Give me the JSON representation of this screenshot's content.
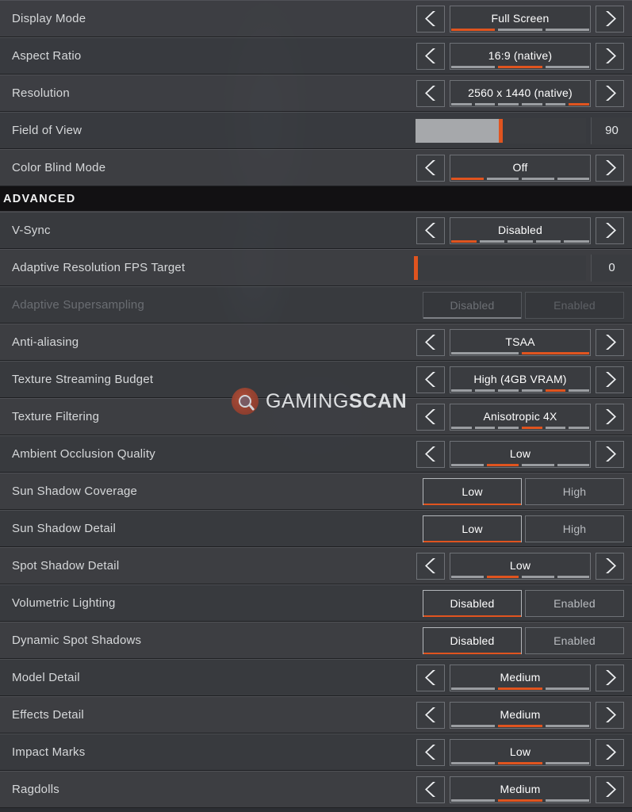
{
  "watermark": {
    "thin": "GAMING",
    "bold": "SCAN",
    "logo_icon": "magnifier-icon"
  },
  "theme": {
    "accent": "#e0541f",
    "row_bg": "#3e4044",
    "control_bg": "#3a3c40",
    "border": "#6e7176",
    "section_bg": "#121113",
    "text": "#d6d8da",
    "text_bright": "#ffffff",
    "text_dim": "#6a6d72",
    "segment_off": "#9a9da1"
  },
  "arrows": {
    "left_icon": "chevron-left-icon",
    "right_icon": "chevron-right-icon"
  },
  "rows": [
    {
      "id": "display-mode",
      "label": "Display Mode",
      "type": "stepper",
      "value": "Full Screen",
      "segments": 3,
      "active": 1
    },
    {
      "id": "aspect-ratio",
      "label": "Aspect Ratio",
      "type": "stepper",
      "value": "16:9 (native)",
      "segments": 3,
      "active": 2
    },
    {
      "id": "resolution",
      "label": "Resolution",
      "type": "stepper",
      "value": "2560 x 1440 (native)",
      "segments": 6,
      "active": 6
    },
    {
      "id": "field-of-view",
      "label": "Field of View",
      "type": "slider",
      "value": "90",
      "percent": 50
    },
    {
      "id": "color-blind-mode",
      "label": "Color Blind Mode",
      "type": "stepper",
      "value": "Off",
      "segments": 4,
      "active": 1
    },
    {
      "id": "advanced",
      "label": "ADVANCED",
      "type": "section"
    },
    {
      "id": "v-sync",
      "label": "V-Sync",
      "type": "stepper",
      "value": "Disabled",
      "segments": 5,
      "active": 1
    },
    {
      "id": "adaptive-res-fps",
      "label": "Adaptive Resolution FPS Target",
      "type": "slider",
      "value": "0",
      "percent": 0
    },
    {
      "id": "adaptive-supersampling",
      "label": "Adaptive Supersampling",
      "type": "toggle",
      "options": [
        "Disabled",
        "Enabled"
      ],
      "selected": 0,
      "disabled": true
    },
    {
      "id": "anti-aliasing",
      "label": "Anti-aliasing",
      "type": "stepper",
      "value": "TSAA",
      "segments": 2,
      "active": 2
    },
    {
      "id": "texture-streaming-budget",
      "label": "Texture Streaming Budget",
      "type": "stepper",
      "value": "High (4GB VRAM)",
      "segments": 6,
      "active": 5
    },
    {
      "id": "texture-filtering",
      "label": "Texture Filtering",
      "type": "stepper",
      "value": "Anisotropic 4X",
      "segments": 6,
      "active": 4
    },
    {
      "id": "ambient-occlusion-quality",
      "label": "Ambient Occlusion Quality",
      "type": "stepper",
      "value": "Low",
      "segments": 4,
      "active": 2
    },
    {
      "id": "sun-shadow-coverage",
      "label": "Sun Shadow Coverage",
      "type": "toggle",
      "options": [
        "Low",
        "High"
      ],
      "selected": 0
    },
    {
      "id": "sun-shadow-detail",
      "label": "Sun Shadow Detail",
      "type": "toggle",
      "options": [
        "Low",
        "High"
      ],
      "selected": 0
    },
    {
      "id": "spot-shadow-detail",
      "label": "Spot Shadow Detail",
      "type": "stepper",
      "value": "Low",
      "segments": 4,
      "active": 2
    },
    {
      "id": "volumetric-lighting",
      "label": "Volumetric Lighting",
      "type": "toggle",
      "options": [
        "Disabled",
        "Enabled"
      ],
      "selected": 0
    },
    {
      "id": "dynamic-spot-shadows",
      "label": "Dynamic Spot Shadows",
      "type": "toggle",
      "options": [
        "Disabled",
        "Enabled"
      ],
      "selected": 0
    },
    {
      "id": "model-detail",
      "label": "Model Detail",
      "type": "stepper",
      "value": "Medium",
      "segments": 3,
      "active": 2
    },
    {
      "id": "effects-detail",
      "label": "Effects Detail",
      "type": "stepper",
      "value": "Medium",
      "segments": 3,
      "active": 2
    },
    {
      "id": "impact-marks",
      "label": "Impact Marks",
      "type": "stepper",
      "value": "Low",
      "segments": 3,
      "active": 2
    },
    {
      "id": "ragdolls",
      "label": "Ragdolls",
      "type": "stepper",
      "value": "Medium",
      "segments": 3,
      "active": 2
    }
  ]
}
